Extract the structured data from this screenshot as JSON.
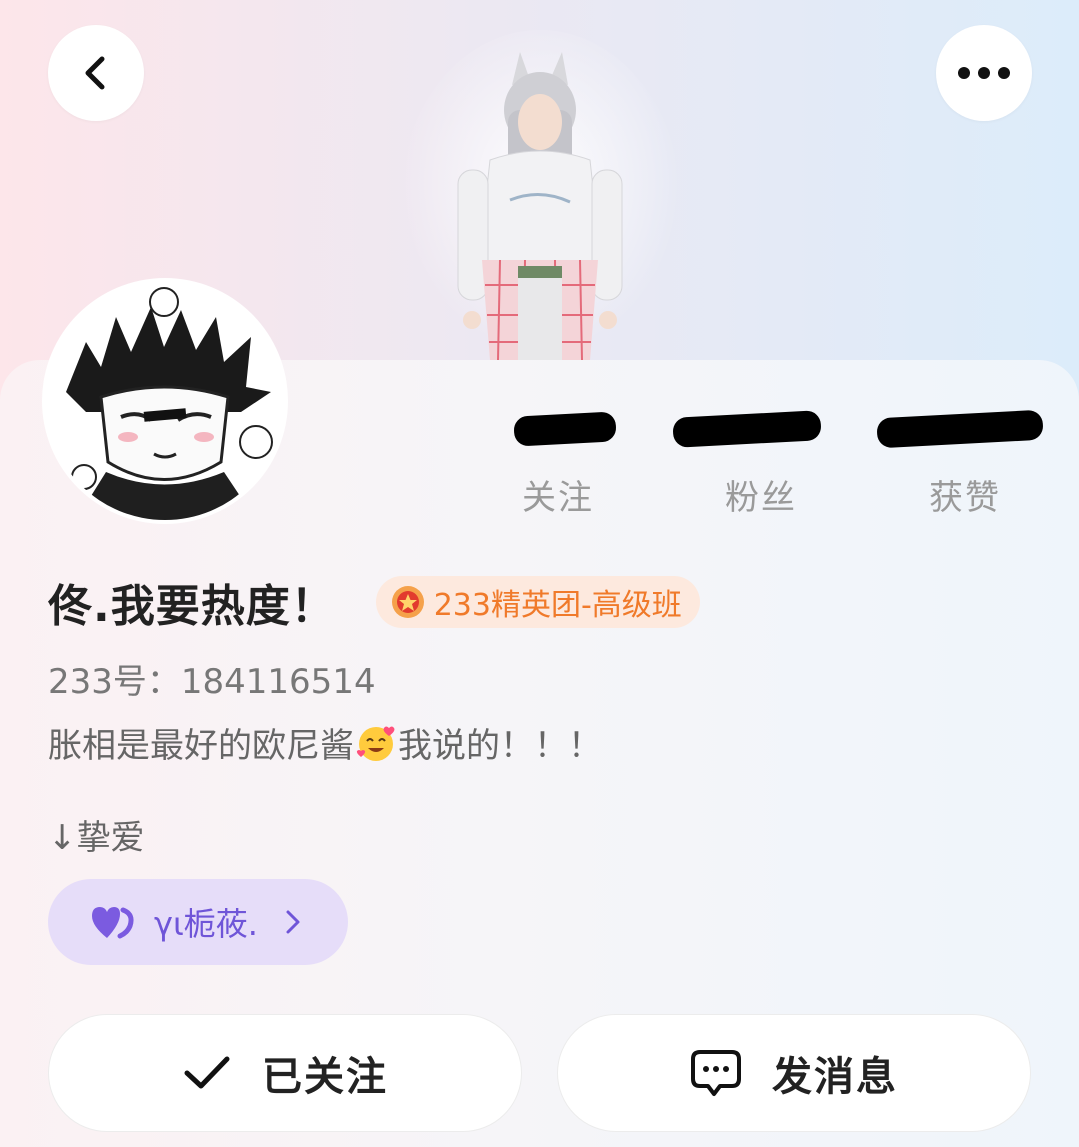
{
  "header": {
    "back_icon": "chevron-left-icon",
    "more_icon": "more-horizontal-icon"
  },
  "stats": [
    {
      "label": "关注",
      "value": ""
    },
    {
      "label": "粉丝",
      "value": ""
    },
    {
      "label": "获赞",
      "value": ""
    }
  ],
  "profile": {
    "username": "佟.我要热度！",
    "badge": "233精英团-高级班",
    "uid": "233号：184116514",
    "bio_part1": "胀相是最好的欧尼酱",
    "bio_part2": "我说的！！！",
    "bio_extra": "↓挚爱"
  },
  "cp": {
    "name": "γι栀莜.",
    "icon": "heart-icon"
  },
  "actions": {
    "follow_label": "已关注",
    "message_label": "发消息"
  },
  "colors": {
    "badge_text": "#f07a2a",
    "cp_text": "#6f55d8",
    "cp_bg": "#e6ddf9"
  }
}
